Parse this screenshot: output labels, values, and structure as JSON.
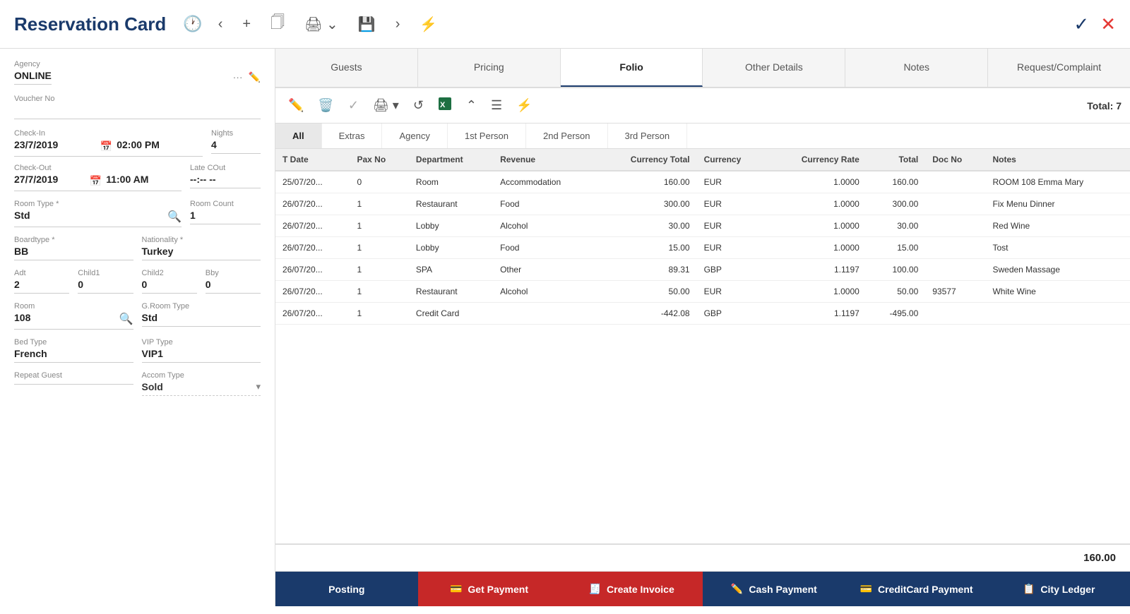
{
  "header": {
    "title": "Reservation Card",
    "checkIcon": "✓",
    "closeIcon": "✕"
  },
  "leftPanel": {
    "agencyLabel": "Agency",
    "agencyValue": "ONLINE",
    "voucherLabel": "Voucher No",
    "checkInLabel": "Check-In",
    "checkInDate": "23/7/2019",
    "checkInTime": "02:00 PM",
    "nightsLabel": "Nights",
    "nightsValue": "4",
    "checkOutLabel": "Check-Out",
    "checkOutDate": "27/7/2019",
    "checkOutTime": "11:00 AM",
    "lateCOutLabel": "Late COut",
    "lateCOutValue": "--:-- --",
    "roomTypeLabel": "Room Type *",
    "roomTypeValue": "Std",
    "roomCountLabel": "Room Count",
    "roomCountValue": "1",
    "boardtypeLabel": "Boardtype *",
    "boardtypeValue": "BB",
    "nationalityLabel": "Nationality *",
    "nationalityValue": "Turkey",
    "adtLabel": "Adt",
    "adtValue": "2",
    "child1Label": "Child1",
    "child1Value": "0",
    "child2Label": "Child2",
    "child2Value": "0",
    "bbyLabel": "Bby",
    "bbyValue": "0",
    "roomLabel": "Room",
    "roomValue": "108",
    "gRoomTypeLabel": "G.Room Type",
    "gRoomTypeValue": "Std",
    "bedTypeLabel": "Bed Type",
    "bedTypeValue": "French",
    "vipTypeLabel": "VIP Type",
    "vipTypeValue": "VIP1",
    "repeatGuestLabel": "Repeat Guest",
    "accomTypeLabel": "Accom Type",
    "accomTypeValue": "Sold"
  },
  "tabs": [
    {
      "label": "Guests",
      "active": false
    },
    {
      "label": "Pricing",
      "active": false
    },
    {
      "label": "Folio",
      "active": true
    },
    {
      "label": "Other Details",
      "active": false
    },
    {
      "label": "Notes",
      "active": false
    },
    {
      "label": "Request/Complaint",
      "active": false
    }
  ],
  "toolbar": {
    "totalLabel": "Total: 7"
  },
  "subTabs": [
    {
      "label": "All",
      "active": true
    },
    {
      "label": "Extras",
      "active": false
    },
    {
      "label": "Agency",
      "active": false
    },
    {
      "label": "1st Person",
      "active": false
    },
    {
      "label": "2nd Person",
      "active": false
    },
    {
      "label": "3rd Person",
      "active": false
    }
  ],
  "tableHeaders": [
    "T Date",
    "Pax No",
    "Department",
    "Revenue",
    "Currency Total",
    "Currency",
    "Currency Rate",
    "Total",
    "Doc No",
    "Notes"
  ],
  "tableRows": [
    {
      "date": "25/07/20...",
      "paxNo": "0",
      "dept": "Room",
      "revenue": "Accommodation",
      "currTotal": "160.00",
      "currency": "EUR",
      "currRate": "1.0000",
      "total": "160.00",
      "docNo": "",
      "notes": "ROOM 108 Emma Mary"
    },
    {
      "date": "26/07/20...",
      "paxNo": "1",
      "dept": "Restaurant",
      "revenue": "Food",
      "currTotal": "300.00",
      "currency": "EUR",
      "currRate": "1.0000",
      "total": "300.00",
      "docNo": "",
      "notes": "Fix Menu Dinner"
    },
    {
      "date": "26/07/20...",
      "paxNo": "1",
      "dept": "Lobby",
      "revenue": "Alcohol",
      "currTotal": "30.00",
      "currency": "EUR",
      "currRate": "1.0000",
      "total": "30.00",
      "docNo": "",
      "notes": "Red Wine"
    },
    {
      "date": "26/07/20...",
      "paxNo": "1",
      "dept": "Lobby",
      "revenue": "Food",
      "currTotal": "15.00",
      "currency": "EUR",
      "currRate": "1.0000",
      "total": "15.00",
      "docNo": "",
      "notes": "Tost"
    },
    {
      "date": "26/07/20...",
      "paxNo": "1",
      "dept": "SPA",
      "revenue": "Other",
      "currTotal": "89.31",
      "currency": "GBP",
      "currRate": "1.1197",
      "total": "100.00",
      "docNo": "",
      "notes": "Sweden Massage"
    },
    {
      "date": "26/07/20...",
      "paxNo": "1",
      "dept": "Restaurant",
      "revenue": "Alcohol",
      "currTotal": "50.00",
      "currency": "EUR",
      "currRate": "1.0000",
      "total": "50.00",
      "docNo": "93577",
      "notes": "White Wine"
    },
    {
      "date": "26/07/20...",
      "paxNo": "1",
      "dept": "Credit Card",
      "revenue": "",
      "currTotal": "-442.08",
      "currency": "GBP",
      "currRate": "1.1197",
      "total": "-495.00",
      "docNo": "",
      "notes": ""
    }
  ],
  "summaryAmount": "160.00",
  "bottomButtons": [
    {
      "label": "Posting",
      "class": "btn-posting",
      "icon": ""
    },
    {
      "label": "Get Payment",
      "class": "btn-get-payment",
      "icon": "💳"
    },
    {
      "label": "Create Invoice",
      "class": "btn-create-invoice",
      "icon": "🧾"
    },
    {
      "label": "Cash Payment",
      "class": "btn-cash-payment",
      "icon": "✏️"
    },
    {
      "label": "CreditCard Payment",
      "class": "btn-credit-card",
      "icon": "💳"
    },
    {
      "label": "City Ledger",
      "class": "btn-city-ledger",
      "icon": "📋"
    }
  ]
}
